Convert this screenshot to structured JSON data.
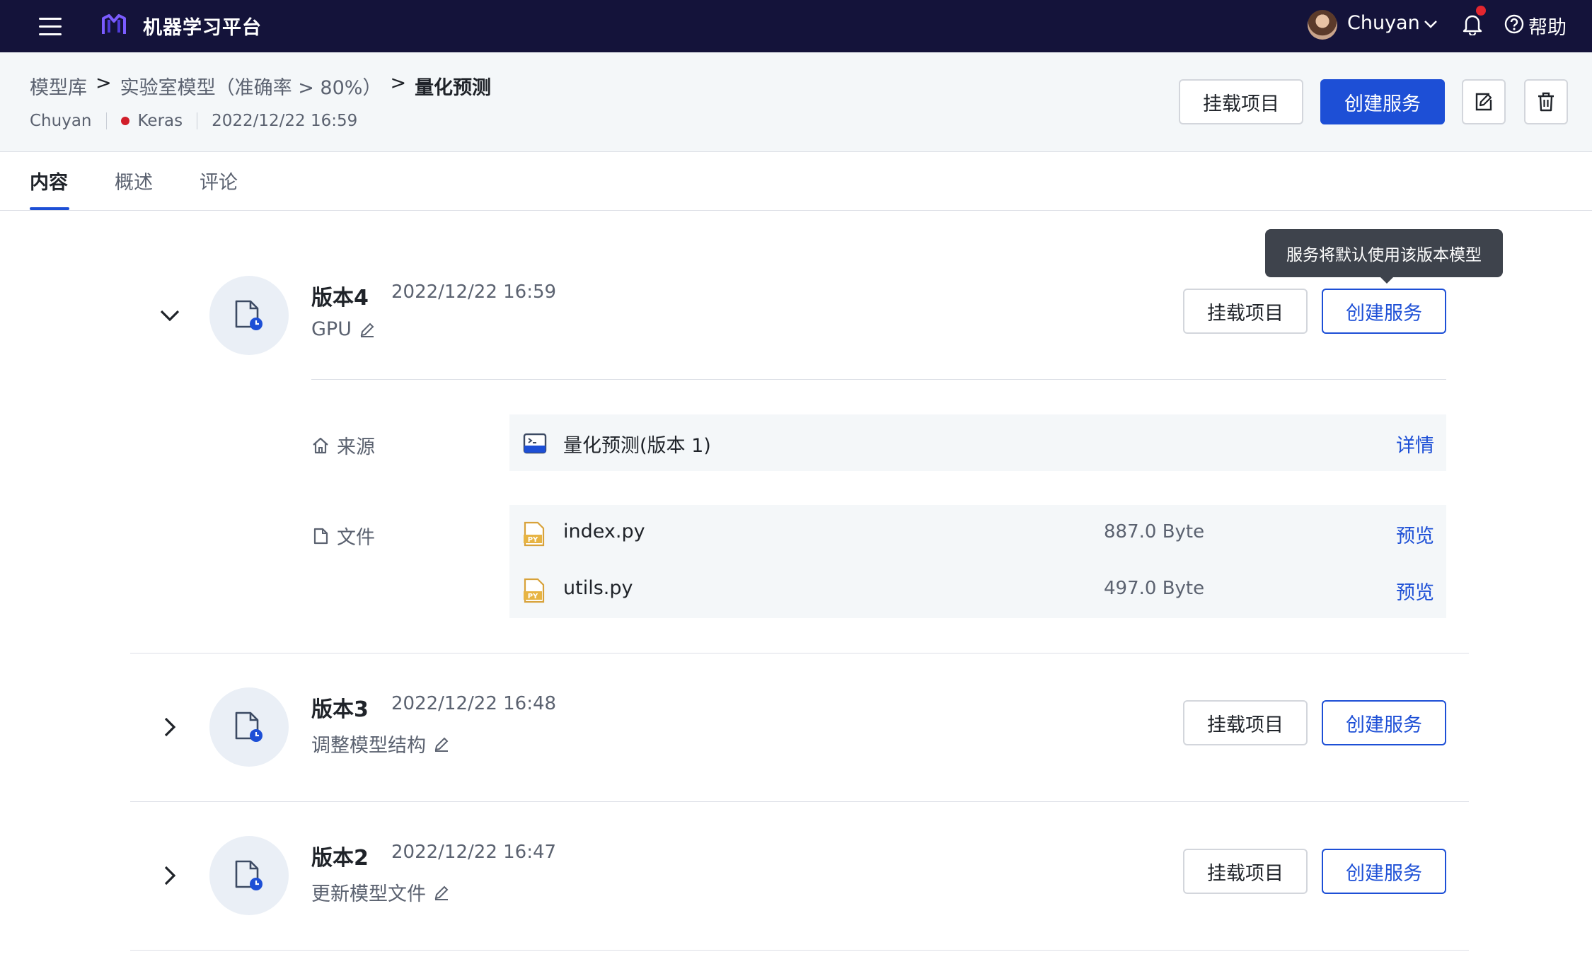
{
  "topbar": {
    "app_title": "机器学习平台",
    "user_name": "Chuyan",
    "help_label": "帮助"
  },
  "header": {
    "breadcrumb": [
      "模型库",
      "实验室模型（准确率 > 80%）",
      "量化预测"
    ],
    "breadcrumb_separator": ">",
    "meta": {
      "owner": "Chuyan",
      "framework": "Keras",
      "framework_status_color": "#d11e2a",
      "created": "2022/12/22 16:59"
    },
    "actions": {
      "mount_label": "挂载项目",
      "create_service_label": "创建服务"
    }
  },
  "tabs": [
    {
      "label": "内容",
      "active": true
    },
    {
      "label": "概述",
      "active": false
    },
    {
      "label": "评论",
      "active": false
    }
  ],
  "tooltip": "服务将默认使用该版本模型",
  "versions": [
    {
      "title": "版本4",
      "time": "2022/12/22 16:59",
      "desc": "GPU",
      "expanded": true,
      "mount_label": "挂载项目",
      "create_label": "创建服务",
      "source": {
        "label": "来源",
        "name": "量化预测(版本 1)",
        "link": "详情"
      },
      "files": {
        "label": "文件",
        "items": [
          {
            "name": "index.py",
            "size": "887.0 Byte",
            "link": "预览"
          },
          {
            "name": "utils.py",
            "size": "497.0 Byte",
            "link": "预览"
          }
        ]
      }
    },
    {
      "title": "版本3",
      "time": "2022/12/22 16:48",
      "desc": "调整模型结构",
      "expanded": false,
      "mount_label": "挂载项目",
      "create_label": "创建服务"
    },
    {
      "title": "版本2",
      "time": "2022/12/22 16:47",
      "desc": "更新模型文件",
      "expanded": false,
      "mount_label": "挂载项目",
      "create_label": "创建服务"
    }
  ],
  "colors": {
    "topbar_bg": "#14133a",
    "accent": "#1d4fd6",
    "header_bg": "#f4f7f9"
  },
  "icons": {
    "menu": "menu-icon",
    "logo": "logo-icon",
    "bell": "bell-icon",
    "help": "help-circle-icon",
    "edit": "edit-icon",
    "delete": "trash-icon",
    "pencil": "pencil-icon",
    "version": "model-file-clock-icon",
    "source": "home-icon",
    "file": "file-icon",
    "python_file": "python-file-icon",
    "terminal": "terminal-window-icon"
  }
}
